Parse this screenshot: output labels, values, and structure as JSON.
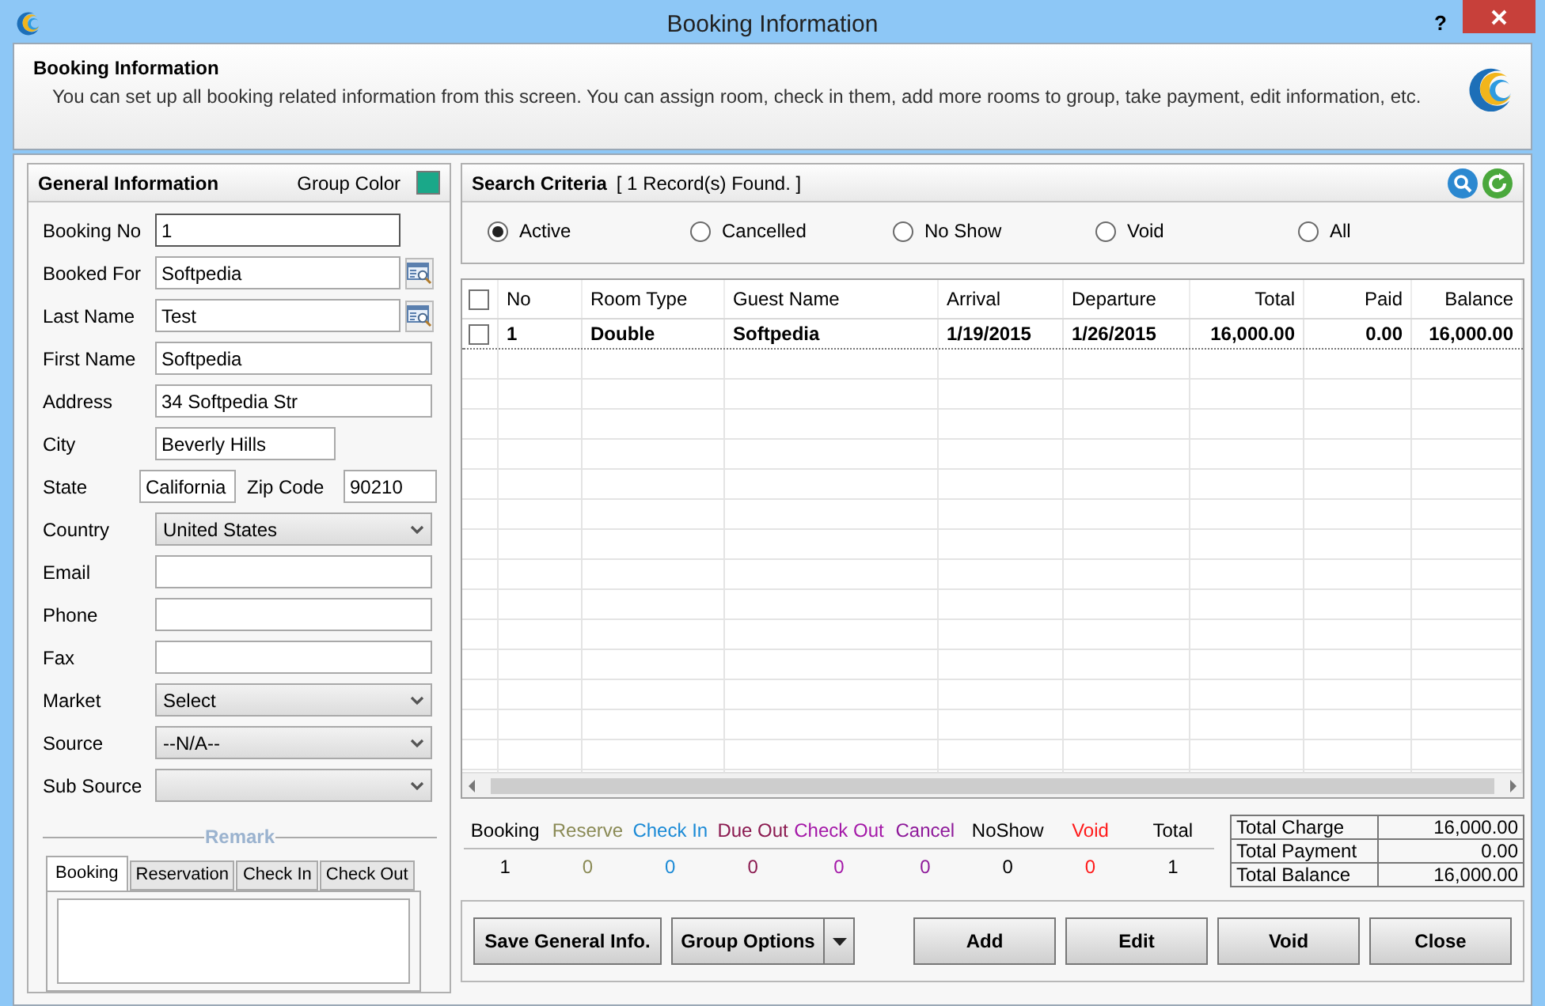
{
  "window": {
    "title": "Booking Information",
    "help_button": "?"
  },
  "header": {
    "title": "Booking Information",
    "description": "You can set up all booking related information from this screen. You can assign room, check in them, add more rooms to group, take payment, edit information, etc."
  },
  "general": {
    "title": "General Information",
    "group_color_label": "Group Color",
    "group_color_swatch": {
      "color": "#1aa889"
    },
    "fields": [
      {
        "kind": "locked",
        "label": "Booking No",
        "value": "1"
      },
      {
        "kind": "lookup",
        "label": "Booked For",
        "value": "Softpedia"
      },
      {
        "kind": "lookup",
        "label": "Last Name",
        "value": "Test"
      },
      {
        "kind": "text",
        "label": "First Name",
        "value": "Softpedia"
      },
      {
        "kind": "text",
        "label": "Address",
        "value": "34 Softpedia Str"
      },
      {
        "kind": "short",
        "label": "City",
        "value": "Beverly Hills"
      },
      {
        "kind": "pair",
        "label": "State",
        "value": "California",
        "label_2": "Zip Code",
        "value_2": "90210"
      },
      {
        "kind": "select",
        "label": "Country",
        "value": "United States"
      },
      {
        "kind": "text",
        "label": "Email"
      },
      {
        "kind": "text",
        "label": "Phone"
      },
      {
        "kind": "text",
        "label": "Fax"
      },
      {
        "kind": "select",
        "label": "Market",
        "value": "Select"
      },
      {
        "kind": "select",
        "label": "Source",
        "value": "--N/A--"
      },
      {
        "kind": "select",
        "label": "Sub Source"
      }
    ],
    "remark": {
      "title": "Remark",
      "tabs": [
        {
          "label": "Booking",
          "selected": true
        },
        {
          "label": "Reservation",
          "selected": false
        },
        {
          "label": "Check In",
          "selected": false
        },
        {
          "label": "Check Out",
          "selected": false
        }
      ]
    }
  },
  "search": {
    "title": "Search Criteria",
    "result": "[ 1 Record(s) Found. ]",
    "options": [
      {
        "label": "Active",
        "selected": true
      },
      {
        "label": "Cancelled",
        "selected": false
      },
      {
        "label": "No Show",
        "selected": false
      },
      {
        "label": "Void",
        "selected": false
      },
      {
        "label": "All",
        "selected": false
      }
    ]
  },
  "table": {
    "select_all_checked": false,
    "columns": [
      {
        "label": "No",
        "kind": "text"
      },
      {
        "label": "Room Type",
        "kind": "text"
      },
      {
        "label": "Guest Name",
        "kind": "text"
      },
      {
        "label": "Arrival",
        "kind": "text"
      },
      {
        "label": "Departure",
        "kind": "text"
      },
      {
        "label": "Total",
        "kind": "amount"
      },
      {
        "label": "Paid",
        "kind": "amount"
      },
      {
        "label": "Balance",
        "kind": "amount"
      }
    ],
    "rows": [
      {
        "checked": false,
        "cells": [
          "1",
          "Double",
          "Softpedia",
          "1/19/2015",
          "1/26/2015",
          "16,000.00",
          "0.00",
          "16,000.00"
        ]
      }
    ]
  },
  "counts": [
    {
      "label": "Booking",
      "value": "1",
      "color": "#000000"
    },
    {
      "label": "Reserve",
      "value": "0",
      "color": "#8a8a55"
    },
    {
      "label": "Check In",
      "value": "0",
      "color": "#1b8ad6"
    },
    {
      "label": "Due Out",
      "value": "0",
      "color": "#8b1a50"
    },
    {
      "label": "Check Out",
      "value": "0",
      "color": "#a418a8"
    },
    {
      "label": "Cancel",
      "value": "0",
      "color": "#8e1a9a"
    },
    {
      "label": "NoShow",
      "value": "0",
      "color": "#000000"
    },
    {
      "label": "Void",
      "value": "0",
      "color": "#ff1a1a"
    },
    {
      "label": "Total",
      "value": "1",
      "color": "#000000"
    }
  ],
  "totals": [
    {
      "label": "Total Charge",
      "value": "16,000.00"
    },
    {
      "label": "Total Payment",
      "value": "0.00"
    },
    {
      "label": "Total Balance",
      "value": "16,000.00"
    }
  ],
  "buttons_left": [
    {
      "label": "Save General Info.",
      "kind": "plain"
    },
    {
      "label": "Group Options",
      "kind": "split"
    }
  ],
  "buttons_right": [
    {
      "label": "Add",
      "kind": "plain"
    },
    {
      "label": "Edit",
      "kind": "plain"
    },
    {
      "label": "Void",
      "kind": "plain"
    },
    {
      "label": "Close",
      "kind": "plain"
    }
  ]
}
